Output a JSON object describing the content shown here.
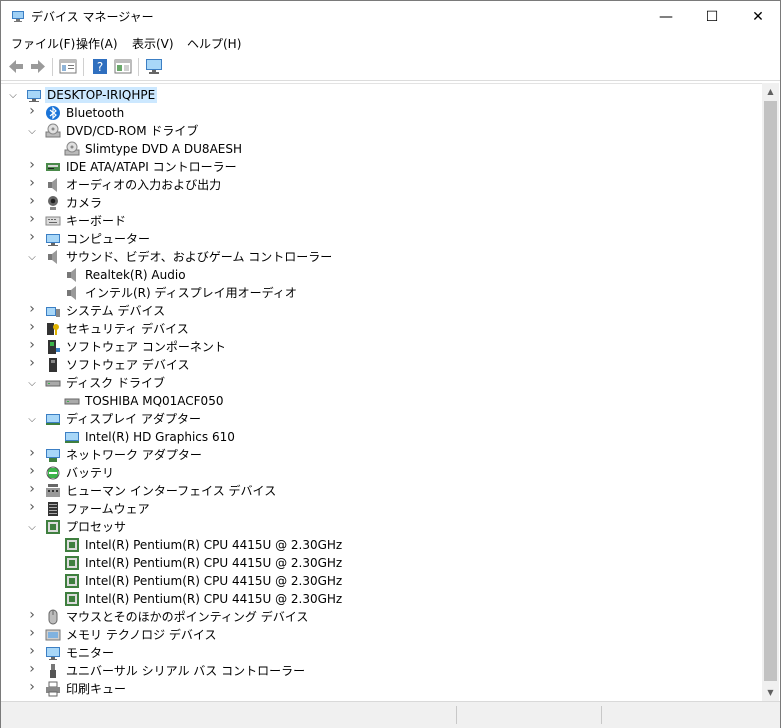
{
  "window": {
    "title": "デバイス マネージャー",
    "controls": {
      "minimize": "—",
      "maximize": "☐",
      "close": "✕"
    }
  },
  "menu": [
    {
      "label": "ファイル(F)"
    },
    {
      "label": "操作(A)"
    },
    {
      "label": "表示(V)"
    },
    {
      "label": "ヘルプ(H)"
    }
  ],
  "toolbar": {
    "buttons": [
      "back-icon",
      "forward-icon",
      "properties-icon",
      "help-icon",
      "update-driver-icon",
      "monitor-icon"
    ]
  },
  "tree": {
    "root": "DESKTOP-IRIQHPE",
    "nodes": [
      {
        "label": "Bluetooth",
        "icon": "bluetooth-icon",
        "level": 1,
        "state": "collapsed"
      },
      {
        "label": "DVD/CD-ROM ドライブ",
        "icon": "dvd-drive-icon",
        "level": 1,
        "state": "expanded"
      },
      {
        "label": "Slimtype DVD A  DU8AESH",
        "icon": "dvd-drive-icon",
        "level": 2,
        "state": "leaf"
      },
      {
        "label": "IDE ATA/ATAPI コントローラー",
        "icon": "ide-controller-icon",
        "level": 1,
        "state": "collapsed"
      },
      {
        "label": "オーディオの入力および出力",
        "icon": "speaker-icon",
        "level": 1,
        "state": "collapsed"
      },
      {
        "label": "カメラ",
        "icon": "camera-icon",
        "level": 1,
        "state": "collapsed"
      },
      {
        "label": "キーボード",
        "icon": "keyboard-icon",
        "level": 1,
        "state": "collapsed"
      },
      {
        "label": "コンピューター",
        "icon": "computer-icon",
        "level": 1,
        "state": "collapsed"
      },
      {
        "label": "サウンド、ビデオ、およびゲーム コントローラー",
        "icon": "speaker-icon",
        "level": 1,
        "state": "expanded"
      },
      {
        "label": "Realtek(R) Audio",
        "icon": "speaker-icon",
        "level": 2,
        "state": "leaf"
      },
      {
        "label": "インテル(R) ディスプレイ用オーディオ",
        "icon": "speaker-icon",
        "level": 2,
        "state": "leaf"
      },
      {
        "label": "システム デバイス",
        "icon": "system-device-icon",
        "level": 1,
        "state": "collapsed"
      },
      {
        "label": "セキュリティ デバイス",
        "icon": "security-device-icon",
        "level": 1,
        "state": "collapsed"
      },
      {
        "label": "ソフトウェア コンポーネント",
        "icon": "software-component-icon",
        "level": 1,
        "state": "collapsed"
      },
      {
        "label": "ソフトウェア デバイス",
        "icon": "software-device-icon",
        "level": 1,
        "state": "collapsed"
      },
      {
        "label": "ディスク ドライブ",
        "icon": "disk-drive-icon",
        "level": 1,
        "state": "expanded"
      },
      {
        "label": "TOSHIBA MQ01ACF050",
        "icon": "disk-drive-icon",
        "level": 2,
        "state": "leaf"
      },
      {
        "label": "ディスプレイ アダプター",
        "icon": "display-adapter-icon",
        "level": 1,
        "state": "expanded"
      },
      {
        "label": "Intel(R) HD Graphics 610",
        "icon": "display-adapter-icon",
        "level": 2,
        "state": "leaf"
      },
      {
        "label": "ネットワーク アダプター",
        "icon": "network-adapter-icon",
        "level": 1,
        "state": "collapsed"
      },
      {
        "label": "バッテリ",
        "icon": "battery-icon",
        "level": 1,
        "state": "collapsed"
      },
      {
        "label": "ヒューマン インターフェイス デバイス",
        "icon": "hid-icon",
        "level": 1,
        "state": "collapsed"
      },
      {
        "label": "ファームウェア",
        "icon": "firmware-icon",
        "level": 1,
        "state": "collapsed"
      },
      {
        "label": "プロセッサ",
        "icon": "processor-icon",
        "level": 1,
        "state": "expanded"
      },
      {
        "label": "Intel(R) Pentium(R) CPU 4415U @ 2.30GHz",
        "icon": "processor-icon",
        "level": 2,
        "state": "leaf"
      },
      {
        "label": "Intel(R) Pentium(R) CPU 4415U @ 2.30GHz",
        "icon": "processor-icon",
        "level": 2,
        "state": "leaf"
      },
      {
        "label": "Intel(R) Pentium(R) CPU 4415U @ 2.30GHz",
        "icon": "processor-icon",
        "level": 2,
        "state": "leaf"
      },
      {
        "label": "Intel(R) Pentium(R) CPU 4415U @ 2.30GHz",
        "icon": "processor-icon",
        "level": 2,
        "state": "leaf"
      },
      {
        "label": "マウスとそのほかのポインティング デバイス",
        "icon": "mouse-icon",
        "level": 1,
        "state": "collapsed"
      },
      {
        "label": "メモリ テクノロジ デバイス",
        "icon": "memory-technology-icon",
        "level": 1,
        "state": "collapsed"
      },
      {
        "label": "モニター",
        "icon": "monitor-icon",
        "level": 1,
        "state": "collapsed"
      },
      {
        "label": "ユニバーサル シリアル バス コントローラー",
        "icon": "usb-icon",
        "level": 1,
        "state": "collapsed"
      },
      {
        "label": "印刷キュー",
        "icon": "printer-icon",
        "level": 1,
        "state": "collapsed"
      }
    ]
  }
}
